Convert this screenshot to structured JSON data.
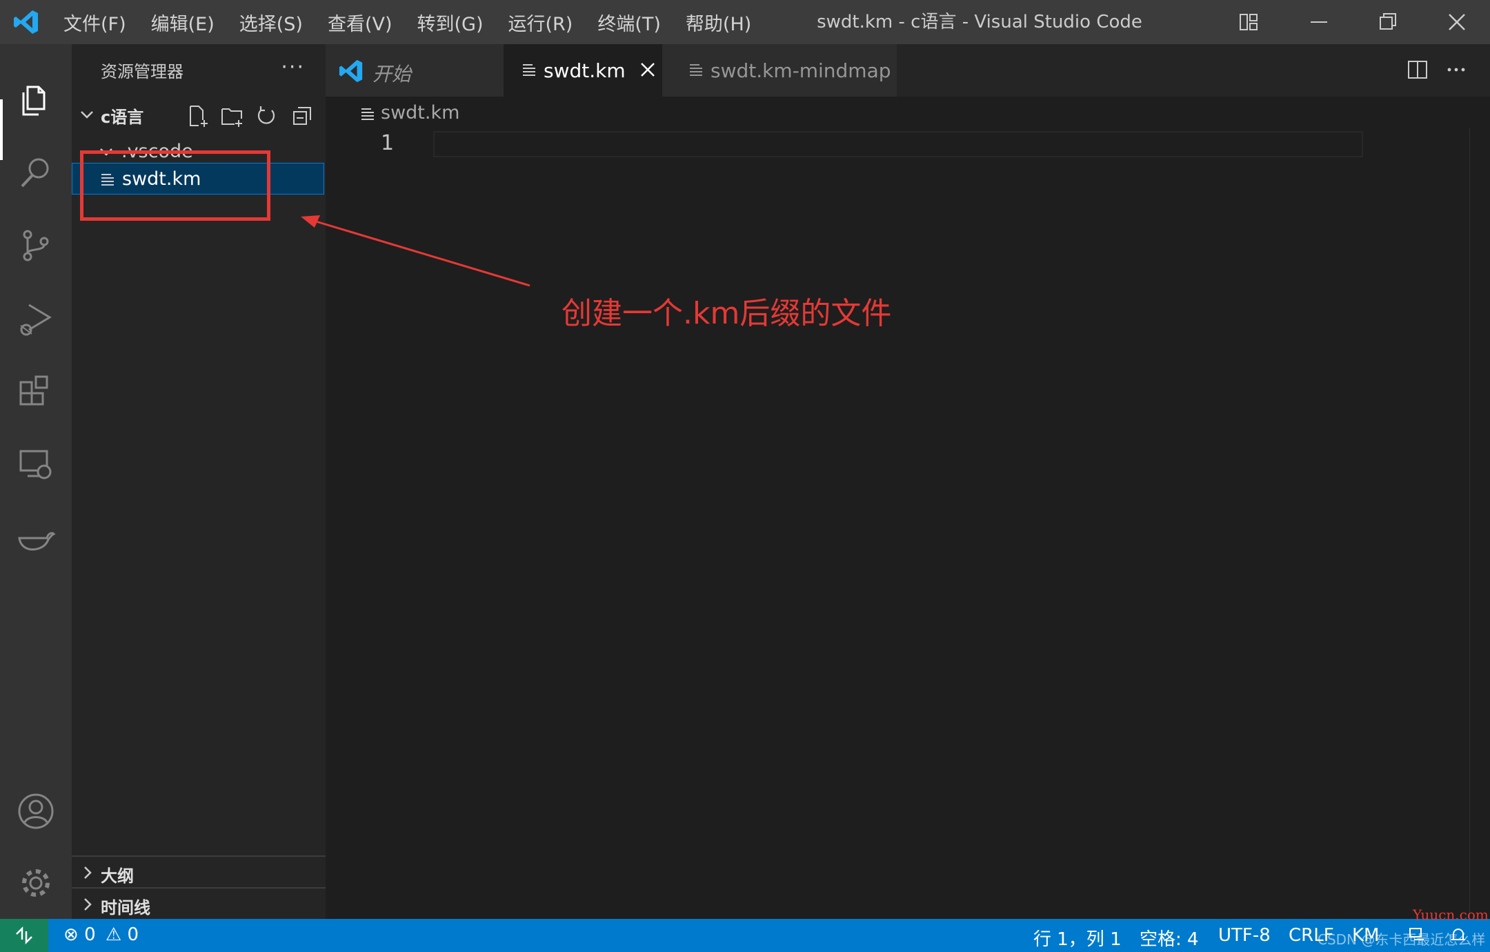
{
  "titlebar": {
    "menu": [
      "文件(F)",
      "编辑(E)",
      "选择(S)",
      "查看(V)",
      "转到(G)",
      "运行(R)",
      "终端(T)",
      "帮助(H)"
    ],
    "window_title": "swdt.km - c语言 - Visual Studio Code",
    "icons": [
      "vscode-logo-icon",
      "layout-icon",
      "minimize-icon",
      "restore-icon",
      "close-icon"
    ]
  },
  "activitybar": {
    "items": [
      "explorer-icon",
      "search-icon",
      "source-control-icon",
      "run-debug-icon",
      "extensions-icon",
      "remote-explorer-icon",
      "docker-icon"
    ],
    "bottom": [
      "account-icon",
      "manage-gear-icon"
    ]
  },
  "sidebar": {
    "title": "资源管理器",
    "more": "···",
    "folder": "c语言",
    "subfolder": ".vscode",
    "file": "swdt.km",
    "sections": [
      "大纲",
      "时间线"
    ]
  },
  "tabs": [
    {
      "label": "开始",
      "icon": "vscode-logo-icon",
      "active": false
    },
    {
      "label": "swdt.km",
      "icon": "file-lines-icon",
      "active": true
    },
    {
      "label": "swdt.km-mindmap",
      "icon": "file-lines-icon",
      "active": false
    }
  ],
  "editor": {
    "breadcrumb": "swdt.km",
    "line_number": "1"
  },
  "annotation": {
    "text": "创建一个.km后缀的文件",
    "color": "#e53935"
  },
  "statusbar": {
    "errors": "0",
    "warnings": "0",
    "position": "行 1，列 1",
    "spaces": "空格: 4",
    "encoding": "UTF-8",
    "eol": "CRLF",
    "language": "KM",
    "watermark": "CSDN @东卡西最近怎么样",
    "site": "Yuucn.com"
  },
  "colors": {
    "accent": "#007acc",
    "remote": "#16825d",
    "selection": "#04395e"
  }
}
